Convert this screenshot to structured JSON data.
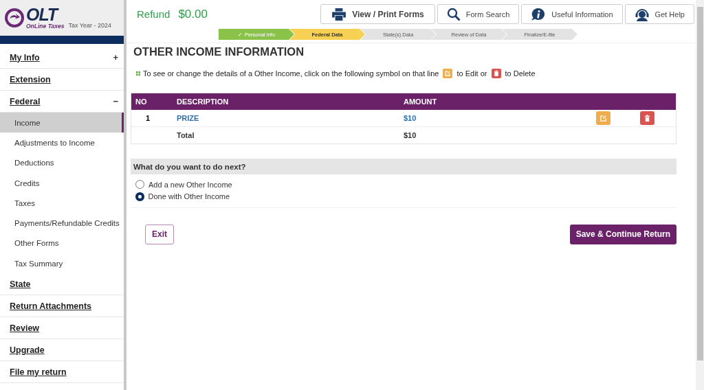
{
  "logo": {
    "mark": "OLT",
    "name": "OnLine Taxes",
    "tax_year": "Tax Year - 2024"
  },
  "refund": {
    "label": "Refund",
    "amount": "$0.00"
  },
  "toolbar": [
    {
      "kind": "print",
      "label": "View / Print Forms"
    },
    {
      "kind": "search",
      "label": "Form Search"
    },
    {
      "kind": "info",
      "label": "Useful Information"
    },
    {
      "kind": "help",
      "label": "Get Help"
    }
  ],
  "steps": [
    {
      "label": "Personal Info",
      "completed": true,
      "selected": false,
      "check": "✓"
    },
    {
      "label": "Federal Data",
      "completed": false,
      "selected": true
    },
    {
      "label": "State(s) Data",
      "completed": false,
      "selected": false
    },
    {
      "label": "Review of Data",
      "completed": false,
      "selected": false
    },
    {
      "label": "Finalize/E-file",
      "completed": false,
      "selected": false
    }
  ],
  "sidebar": {
    "items": [
      {
        "label": "My Info",
        "toggle": "+"
      },
      {
        "label": "Extension"
      },
      {
        "label": "Federal",
        "toggle": "−",
        "children": [
          {
            "label": "Income",
            "selected": true
          },
          {
            "label": "Adjustments to Income",
            "selected": false
          },
          {
            "label": "Deductions",
            "selected": false
          },
          {
            "label": "Credits",
            "selected": false
          },
          {
            "label": "Taxes",
            "selected": false
          },
          {
            "label": "Payments/Refundable Credits",
            "selected": false
          },
          {
            "label": "Other Forms",
            "selected": false
          },
          {
            "label": "Tax Summary",
            "selected": false
          }
        ]
      },
      {
        "label": "State"
      },
      {
        "label": "Return Attachments"
      },
      {
        "label": "Review"
      },
      {
        "label": "Upgrade"
      },
      {
        "label": "File my return"
      }
    ]
  },
  "page_title": "OTHER INCOME INFORMATION",
  "instruction": {
    "before": "To see or change the details of a Other Income, click on the following symbol on that line",
    "middle": "to Edit or",
    "after": "to Delete"
  },
  "table": {
    "columns": [
      "NO",
      "DESCRIPTION",
      "AMOUNT"
    ],
    "rows": [
      {
        "no": "1",
        "description": "PRIZE",
        "amount": "$10"
      }
    ],
    "total": {
      "label": "Total",
      "amount": "$10"
    }
  },
  "next": {
    "question": "What do you want to do next?",
    "options": [
      {
        "label": "Add a new Other Income",
        "selected": false
      },
      {
        "label": "Done with Other Income",
        "selected": true
      }
    ]
  },
  "buttons": {
    "exit": "Exit",
    "continue": "Save & Continue Return"
  }
}
